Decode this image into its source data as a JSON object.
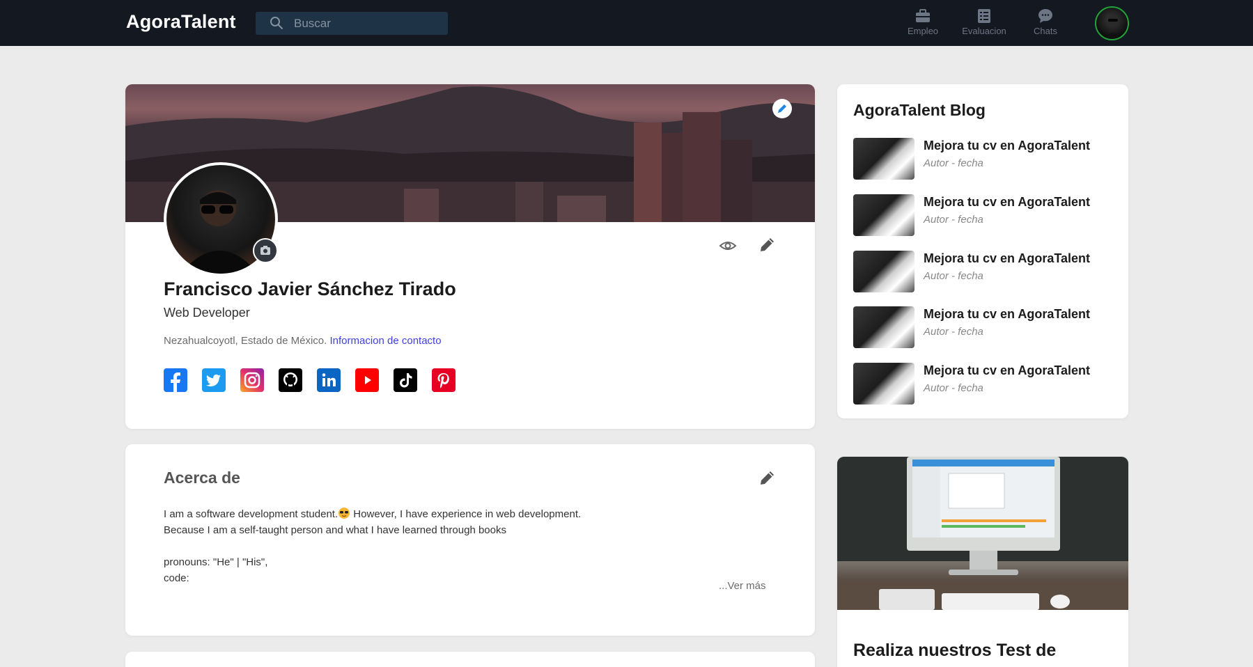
{
  "app": {
    "brand": "AgoraTalent"
  },
  "search": {
    "placeholder": "Buscar"
  },
  "nav": [
    {
      "label": "Empleo",
      "icon": "briefcase-icon"
    },
    {
      "label": "Evaluacion",
      "icon": "checklist-icon"
    },
    {
      "label": "Chats",
      "icon": "chat-icon"
    }
  ],
  "profile": {
    "name": "Francisco Javier Sánchez Tirado",
    "headline": "Web Developer",
    "location": "Nezahualcoyotl, Estado de México.",
    "contact_link": "Informacion de contacto",
    "socials": [
      {
        "name": "facebook",
        "color": "#1877f2"
      },
      {
        "name": "twitter",
        "color": "#1d9bf0"
      },
      {
        "name": "instagram",
        "color": "#e1306c"
      },
      {
        "name": "github",
        "color": "#000000"
      },
      {
        "name": "linkedin",
        "color": "#0a66c2"
      },
      {
        "name": "youtube",
        "color": "#ff0000"
      },
      {
        "name": "tiktok",
        "color": "#000000"
      },
      {
        "name": "pinterest",
        "color": "#e60023"
      }
    ]
  },
  "about": {
    "title": "Acerca de",
    "line1": "I am a software development student.",
    "line1b": " However, I have experience in web development.",
    "line2": "Because I am a self-taught person and what I have learned through books",
    "line3": "pronouns: \"He\" | \"His\",",
    "line4": "code:",
    "more": "...Ver más"
  },
  "blog": {
    "title": "AgoraTalent Blog",
    "items": [
      {
        "title": "Mejora tu cv en AgoraTalent",
        "meta": "Autor - fecha"
      },
      {
        "title": "Mejora tu cv en AgoraTalent",
        "meta": "Autor - fecha"
      },
      {
        "title": "Mejora tu cv en AgoraTalent",
        "meta": "Autor - fecha"
      },
      {
        "title": "Mejora tu cv en AgoraTalent",
        "meta": "Autor - fecha"
      },
      {
        "title": "Mejora tu cv en AgoraTalent",
        "meta": "Autor - fecha"
      }
    ]
  },
  "test_card": {
    "title": "Realiza nuestros Test de"
  },
  "colors": {
    "topbar": "#141821",
    "link": "#3e3ee0",
    "avatar_ring": "#21a33a",
    "edit_blue": "#1e88e5"
  }
}
